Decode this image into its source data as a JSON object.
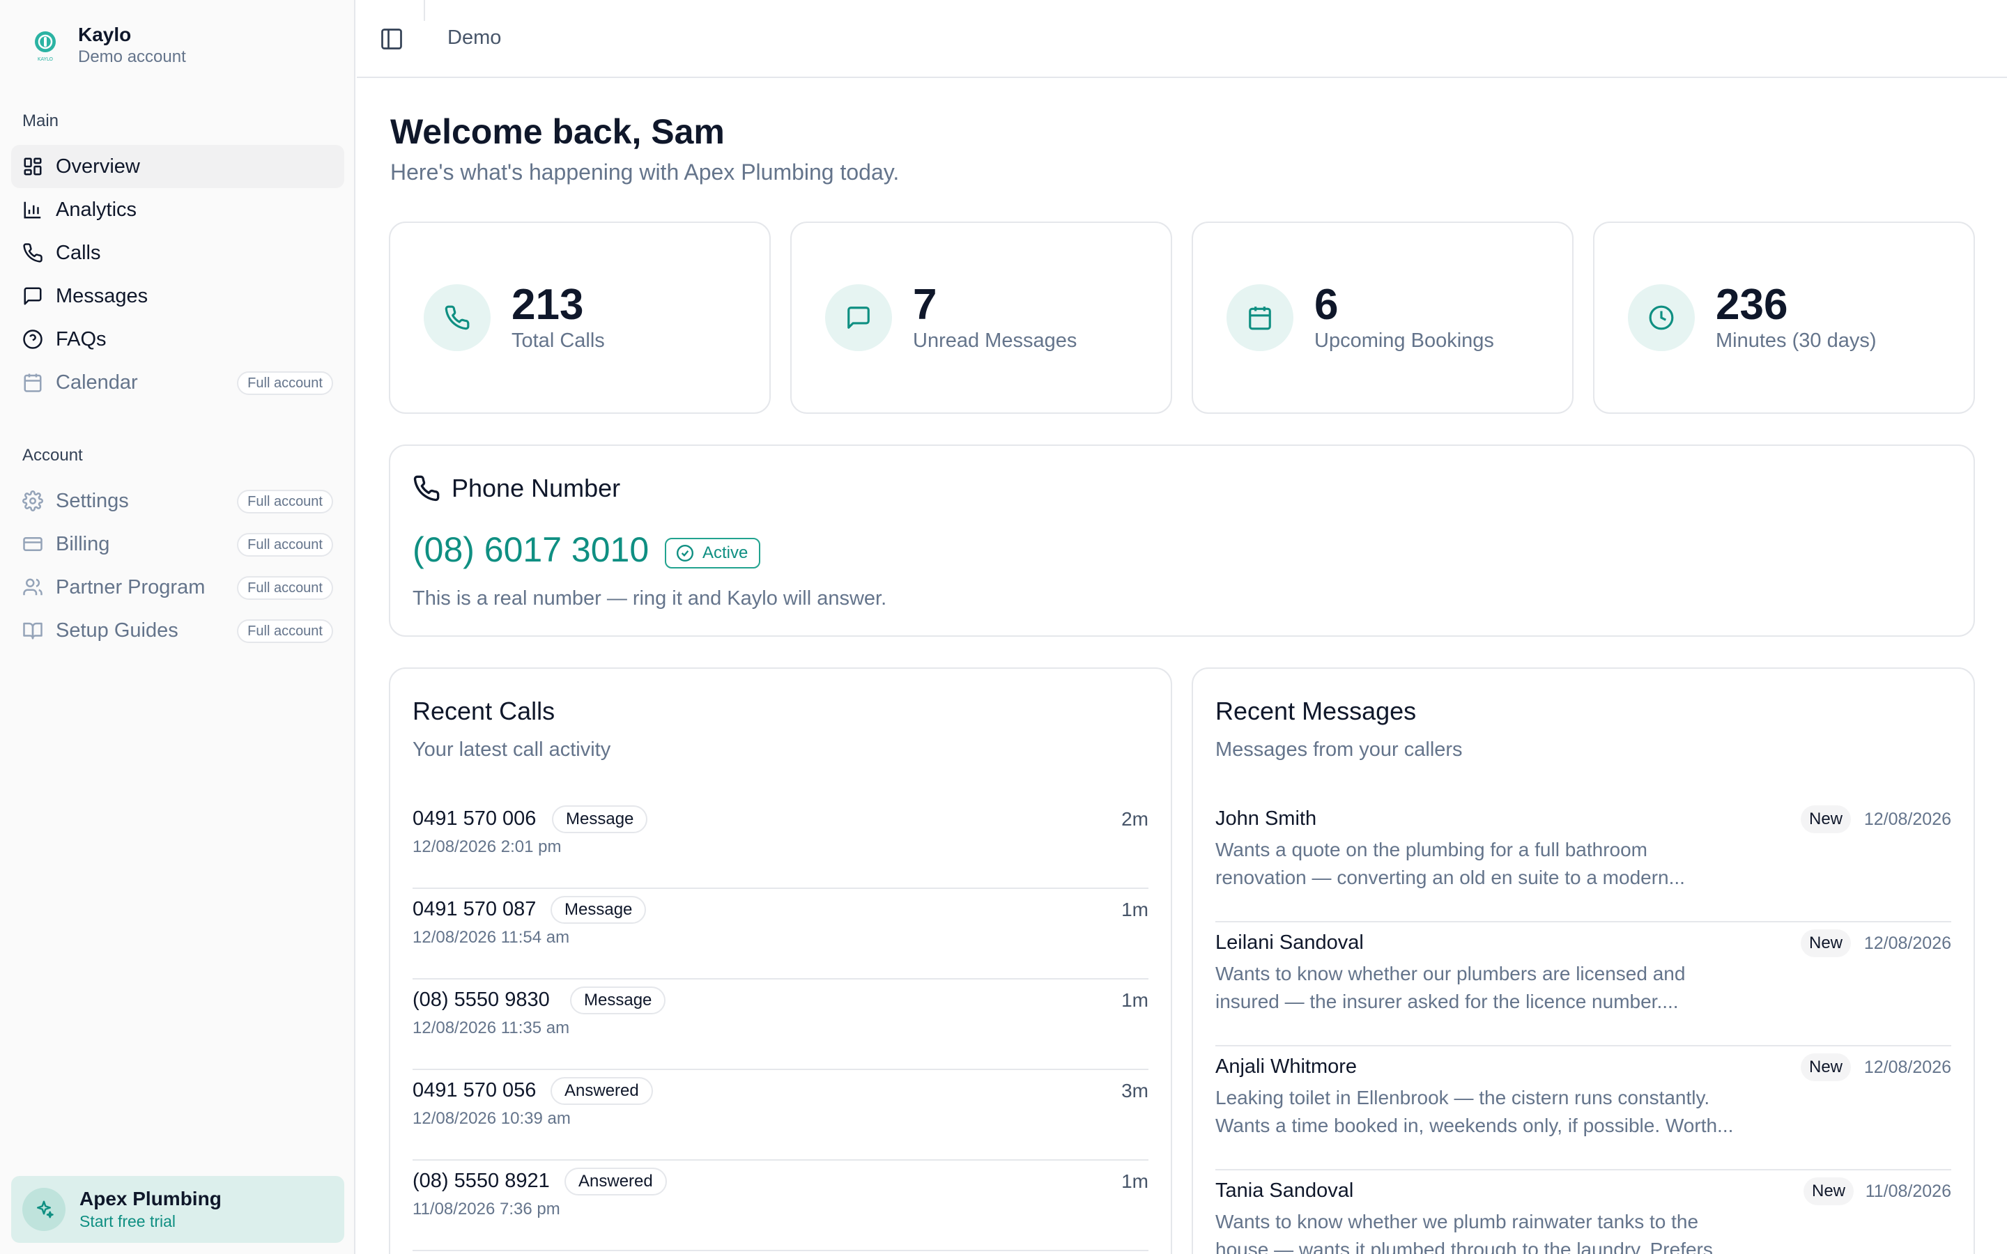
{
  "brand": {
    "name": "Kaylo",
    "subtitle": "Demo account",
    "logo_text": "KAYLO"
  },
  "sidebar": {
    "main_label": "Main",
    "main_items": [
      {
        "label": "Overview",
        "icon": "grid-icon"
      },
      {
        "label": "Analytics",
        "icon": "bar-chart-icon"
      },
      {
        "label": "Calls",
        "icon": "phone-icon"
      },
      {
        "label": "Messages",
        "icon": "message-icon"
      },
      {
        "label": "FAQs",
        "icon": "help-circle-icon"
      },
      {
        "label": "Calendar",
        "icon": "calendar-icon",
        "pill": "Full account"
      }
    ],
    "account_label": "Account",
    "account_items": [
      {
        "label": "Settings",
        "icon": "gear-icon",
        "pill": "Full account"
      },
      {
        "label": "Billing",
        "icon": "credit-card-icon",
        "pill": "Full account"
      },
      {
        "label": "Partner Program",
        "icon": "users-icon",
        "pill": "Full account"
      },
      {
        "label": "Setup Guides",
        "icon": "book-icon",
        "pill": "Full account"
      }
    ],
    "trial": {
      "title": "Apex Plumbing",
      "cta": "Start free trial"
    }
  },
  "header": {
    "breadcrumb": "Demo"
  },
  "main": {
    "welcome": "Welcome back, Sam",
    "subtitle": "Here's what's happening with Apex Plumbing today.",
    "stats": [
      {
        "value": "213",
        "label": "Total Calls",
        "icon": "phone-icon"
      },
      {
        "value": "7",
        "label": "Unread Messages",
        "icon": "message-icon"
      },
      {
        "value": "6",
        "label": "Upcoming Bookings",
        "icon": "calendar-icon"
      },
      {
        "value": "236",
        "label": "Minutes (30 days)",
        "icon": "clock-icon"
      }
    ],
    "phone": {
      "title": "Phone Number",
      "number": "(08) 6017 3010",
      "status": "Active",
      "note": "This is a real number — ring it and Kaylo will answer."
    },
    "recent_calls": {
      "title": "Recent Calls",
      "subtitle": "Your latest call activity",
      "rows": [
        {
          "number": "0491 570 006",
          "tag": "Message",
          "date": "12/08/2026 2:01 pm",
          "duration": "2m"
        },
        {
          "number": "0491 570 087",
          "tag": "Message",
          "date": "12/08/2026 11:54 am",
          "duration": "1m"
        },
        {
          "number": "(08) 5550 9830",
          "tag": "Message",
          "date": "12/08/2026 11:35 am",
          "duration": "1m"
        },
        {
          "number": "0491 570 056",
          "tag": "Answered",
          "date": "12/08/2026 10:39 am",
          "duration": "3m"
        },
        {
          "number": "(08) 5550 8921",
          "tag": "Answered",
          "date": "11/08/2026 7:36 pm",
          "duration": "1m"
        }
      ]
    },
    "recent_messages": {
      "title": "Recent Messages",
      "subtitle": "Messages from your callers",
      "rows": [
        {
          "name": "John Smith",
          "badge": "New",
          "date": "12/08/2026",
          "line1": "Wants a quote on the plumbing for a full bathroom",
          "line2": "renovation — converting an old en suite to a modern..."
        },
        {
          "name": "Leilani Sandoval",
          "badge": "New",
          "date": "12/08/2026",
          "line1": "Wants to know whether our plumbers are licensed and",
          "line2": "insured — the insurer asked for the licence number...."
        },
        {
          "name": "Anjali Whitmore",
          "badge": "New",
          "date": "12/08/2026",
          "line1": "Leaking toilet in Ellenbrook — the cistern runs constantly.",
          "line2": "Wants a time booked in, weekends only, if possible. Worth..."
        },
        {
          "name": "Tania Sandoval",
          "badge": "New",
          "date": "11/08/2026",
          "line1": "Wants to know whether we plumb rainwater tanks to the",
          "line2": "house — wants it plumbed through to the laundry. Prefers ..."
        }
      ]
    }
  },
  "colors": {
    "accent": "#0f8f82",
    "accent_bg": "#e6f4f2",
    "muted_text": "#64748b",
    "border": "#e5e7eb"
  }
}
